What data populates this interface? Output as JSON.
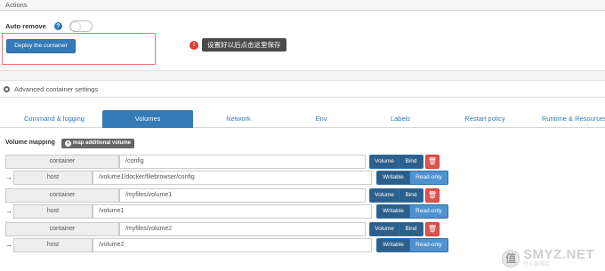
{
  "actions": {
    "header": "Actions",
    "auto_remove_label": "Auto remove",
    "help_icon": "?",
    "deploy_label": "Deploy the container",
    "annotation_number": "!",
    "annotation_text": "设置好以后点击这里保存"
  },
  "advanced": {
    "header": "Advanced container settings",
    "tabs": [
      {
        "label": "Command & logging",
        "active": false
      },
      {
        "label": "Volumes",
        "active": true
      },
      {
        "label": "Network",
        "active": false
      },
      {
        "label": "Env",
        "active": false
      },
      {
        "label": "Labels",
        "active": false
      },
      {
        "label": "Restart policy",
        "active": false
      },
      {
        "label": "Runtime & Resources",
        "active": false
      }
    ]
  },
  "volumes": {
    "title": "Volume mapping",
    "map_button": "map additional volume",
    "rows": [
      {
        "container_label": "container",
        "container_value": "/config",
        "volume_btn": "Volume",
        "bind_btn": "Bind",
        "host_label": "host",
        "host_value": "/volume1/docker/filebrowser/config",
        "writable_btn": "Writable",
        "readonly_btn": "Read-only"
      },
      {
        "container_label": "container",
        "container_value": "/myfiles/volume1",
        "volume_btn": "Volume",
        "bind_btn": "Bind",
        "host_label": "host",
        "host_value": "/volume1",
        "writable_btn": "Writable",
        "readonly_btn": "Read-only"
      },
      {
        "container_label": "container",
        "container_value": "/myfiles/volume2",
        "volume_btn": "Volume",
        "bind_btn": "Bind",
        "host_label": "host",
        "host_value": "/volume2",
        "writable_btn": "Writable",
        "readonly_btn": "Read-only"
      }
    ],
    "arrow_icon": "→",
    "delete_icon": "trash-icon"
  },
  "watermark": {
    "logo_text": "值",
    "main": "SMYZ.NET",
    "sub": "什么值得买"
  },
  "colors": {
    "primary": "#337ab7",
    "danger": "#d9534f",
    "annotation": "#e53935"
  }
}
